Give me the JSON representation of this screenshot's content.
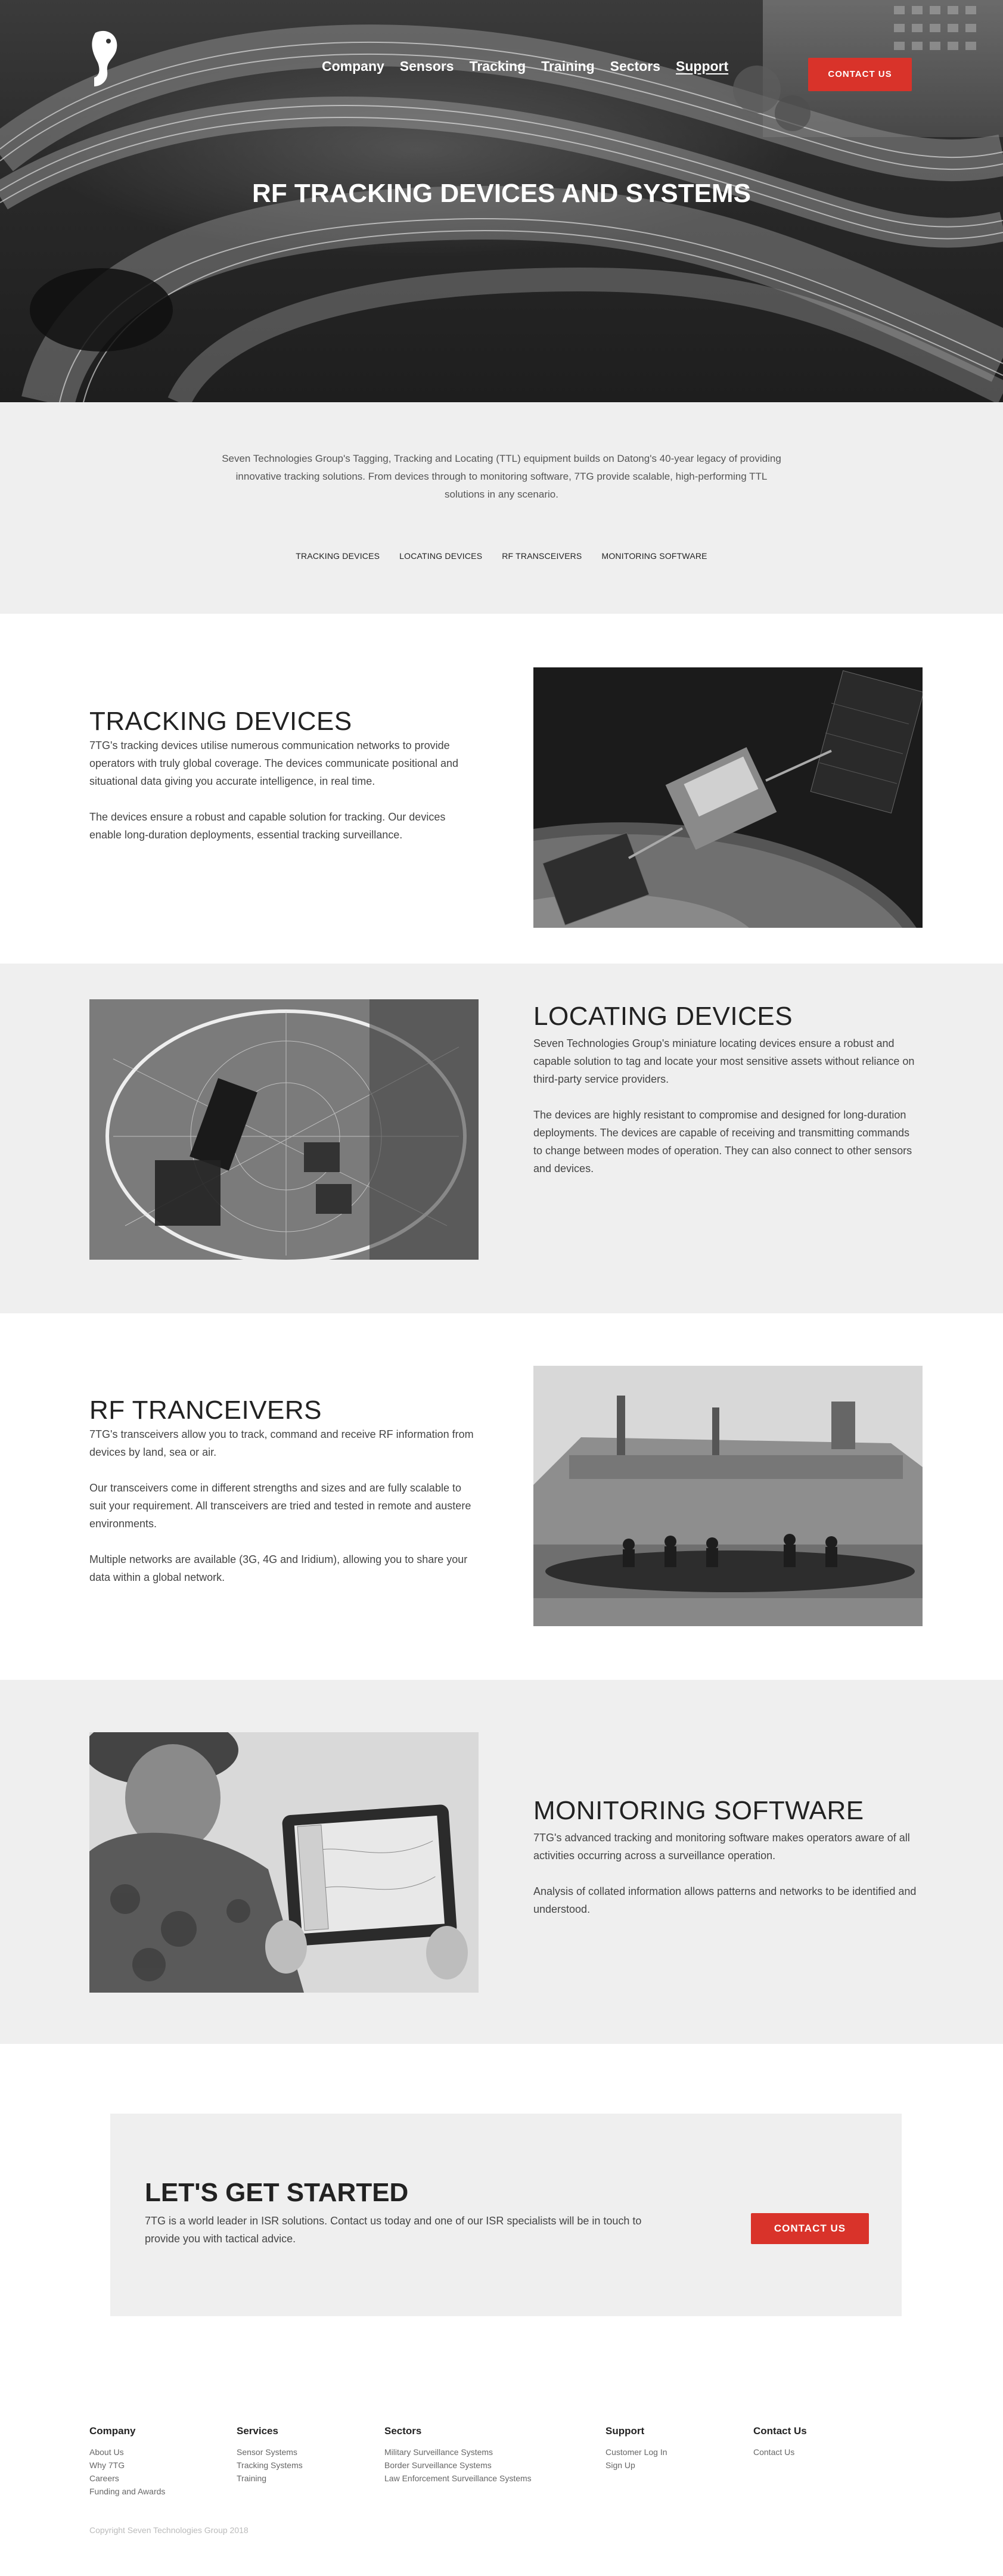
{
  "nav": {
    "items": [
      {
        "label": "Company"
      },
      {
        "label": "Sensors"
      },
      {
        "label": "Tracking"
      },
      {
        "label": "Training"
      },
      {
        "label": "Sectors"
      },
      {
        "label": "Support"
      }
    ],
    "cta_label": "CONTACT US"
  },
  "hero": {
    "title": "RF TRACKING DEVICES AND SYSTEMS"
  },
  "intro": {
    "text": "Seven Technologies Group's Tagging, Tracking and Locating (TTL) equipment builds on Datong's 40-year legacy of providing innovative tracking solutions. From devices through to monitoring software, 7TG provide scalable, high-performing TTL solutions in any scenario.",
    "links": [
      "TRACKING DEVICES",
      "LOCATING DEVICES",
      "RF TRANSCEIVERS",
      "MONITORING SOFTWARE"
    ]
  },
  "sections": [
    {
      "title": "TRACKING DEVICES",
      "paragraphs": [
        "7TG's tracking devices utilise numerous communication networks to provide operators with truly global coverage. The devices communicate positional and situational data giving you accurate intelligence, in real time.",
        "The devices ensure a robust and capable solution for tracking. Our devices enable long-duration deployments, essential tracking surveillance."
      ]
    },
    {
      "title": "LOCATING DEVICES",
      "paragraphs": [
        "Seven Technologies Group's miniature locating devices ensure a robust and capable solution to tag and locate your most sensitive assets without reliance on third-party service providers.",
        "The devices are highly resistant to compromise and designed for long-duration deployments. The devices are capable of receiving and transmitting commands to change between modes of operation. They can also connect to other sensors and devices."
      ]
    },
    {
      "title": "RF TRANCEIVERS",
      "paragraphs": [
        "7TG's transceivers allow you to track, command and receive RF information from devices by land, sea or air.",
        "Our transceivers come in different strengths and sizes and are fully scalable to suit your requirement. All transceivers are tried and tested in remote and austere environments.",
        "Multiple networks are available (3G, 4G and Iridium), allowing you to share your data within a global network."
      ]
    },
    {
      "title": "MONITORING SOFTWARE",
      "paragraphs": [
        "7TG's advanced tracking and monitoring software makes operators aware of all activities occurring across a surveillance operation.",
        "Analysis of collated information allows patterns and networks to be identified and understood."
      ]
    }
  ],
  "cta": {
    "title": "LET'S GET STARTED",
    "text": "7TG is a world leader in ISR solutions. Contact us today and one of our ISR specialists will be in touch to provide you with tactical advice.",
    "button": "CONTACT US"
  },
  "footer": {
    "columns": [
      {
        "heading": "Company",
        "links": [
          "About Us",
          "Why 7TG",
          "Careers",
          "Funding and Awards"
        ]
      },
      {
        "heading": "Services",
        "links": [
          "Sensor Systems",
          "Tracking Systems",
          "Training"
        ]
      },
      {
        "heading": "Sectors",
        "links": [
          "Military Surveillance Systems",
          "Border Surveillance Systems",
          "Law Enforcement Surveillance Systems"
        ]
      },
      {
        "heading": "Support",
        "links": [
          "Customer Log In",
          "Sign Up"
        ]
      },
      {
        "heading": "Contact Us",
        "links": [
          "Contact Us"
        ]
      }
    ],
    "copyright": "Copyright Seven Technologies Group 2018"
  },
  "colors": {
    "accent": "#d9332a",
    "panel": "#efefef"
  }
}
